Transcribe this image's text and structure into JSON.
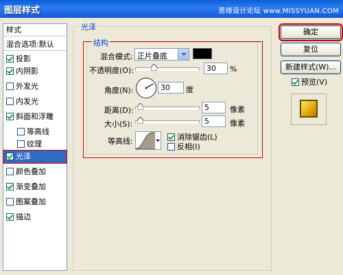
{
  "window": {
    "title": "图层样式",
    "watermark": "思缘设计论坛 www.MISSYUAN.COM"
  },
  "sidebar": {
    "header": "样式",
    "items": [
      {
        "label": "混合选项:默认",
        "checkbox": false
      },
      {
        "label": "投影",
        "checkbox": true,
        "checked": true
      },
      {
        "label": "内阴影",
        "checkbox": true,
        "checked": true
      },
      {
        "label": "外发光",
        "checkbox": true,
        "checked": false
      },
      {
        "label": "内发光",
        "checkbox": true,
        "checked": false
      },
      {
        "label": "斜面和浮雕",
        "checkbox": true,
        "checked": true
      },
      {
        "label": "等高线",
        "checkbox": true,
        "checked": false,
        "indent": true
      },
      {
        "label": "纹理",
        "checkbox": true,
        "checked": false,
        "indent": true
      },
      {
        "label": "光泽",
        "checkbox": true,
        "checked": true,
        "selected": true
      },
      {
        "label": "颜色叠加",
        "checkbox": true,
        "checked": false
      },
      {
        "label": "渐变叠加",
        "checkbox": true,
        "checked": true
      },
      {
        "label": "图案叠加",
        "checkbox": true,
        "checked": false
      },
      {
        "label": "描边",
        "checkbox": true,
        "checked": true
      }
    ]
  },
  "panel": {
    "section_title": "光泽",
    "group_title": "结构",
    "blend_mode": {
      "label": "混合模式:",
      "value": "正片叠底",
      "color": "#000000"
    },
    "opacity": {
      "label": "不透明度(O):",
      "value": "30",
      "unit": "%",
      "percent": 30
    },
    "angle": {
      "label": "角度(N):",
      "value": "30",
      "unit": "度",
      "degrees": 30
    },
    "distance": {
      "label": "距离(D):",
      "value": "5",
      "unit": "像素"
    },
    "size": {
      "label": "大小(S):",
      "value": "5",
      "unit": "像素"
    },
    "contour": {
      "label": "等高线:"
    },
    "antialias": {
      "label": "消除锯齿(L)",
      "checked": true
    },
    "invert": {
      "label": "反相(I)",
      "checked": false
    }
  },
  "buttons": {
    "ok": "确定",
    "reset": "复位",
    "new_style": "新建样式(W)...",
    "preview": {
      "label": "预览(V)",
      "checked": true
    }
  }
}
